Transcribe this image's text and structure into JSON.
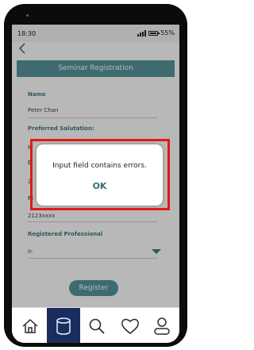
{
  "status_bar": {
    "time": "18:30",
    "battery": "55%"
  },
  "header": {
    "title": "Seminar Registration"
  },
  "form": {
    "name_label": "Name",
    "name_value": "Peter Chan",
    "salutation_label": "Preferred Salutation:",
    "salutation_value_fragment": "M",
    "field3_label_fragment": "D",
    "field3_value_fragment": "2",
    "field4_label_fragment": "M",
    "phone_value": "2123xxxx",
    "professional_label": "Registered Professional",
    "professional_value": "Ir."
  },
  "register_button": {
    "label": "Register"
  },
  "alert": {
    "message": "Input field contains errors.",
    "ok_label": "OK"
  },
  "tabs": [
    {
      "icon": "home-icon",
      "active": false
    },
    {
      "icon": "database-icon",
      "active": true
    },
    {
      "icon": "search-icon",
      "active": false
    },
    {
      "icon": "heart-icon",
      "active": false
    },
    {
      "icon": "user-icon",
      "active": false
    }
  ],
  "colors": {
    "accent": "#56959b",
    "alert_outline": "#e11a14",
    "active_tab": "#1a2d5e"
  }
}
